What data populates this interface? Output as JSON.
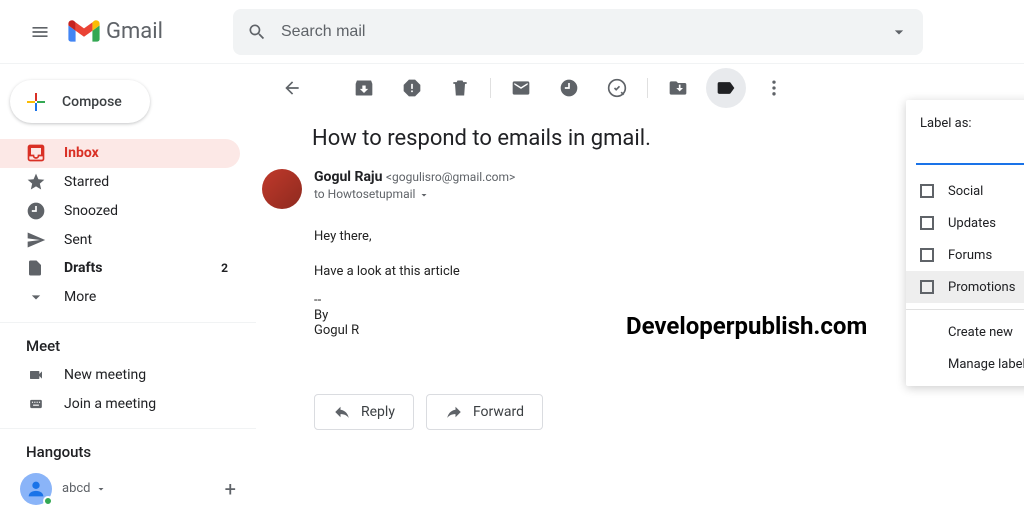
{
  "header": {
    "product": "Gmail",
    "search_placeholder": "Search mail"
  },
  "compose_label": "Compose",
  "sidebar": {
    "items": [
      {
        "label": "Inbox",
        "icon": "inbox"
      },
      {
        "label": "Starred",
        "icon": "star"
      },
      {
        "label": "Snoozed",
        "icon": "clock"
      },
      {
        "label": "Sent",
        "icon": "send"
      },
      {
        "label": "Drafts",
        "icon": "file",
        "count": "2"
      },
      {
        "label": "More",
        "icon": "expand"
      }
    ]
  },
  "meet": {
    "title": "Meet",
    "new_meeting": "New meeting",
    "join_meeting": "Join a meeting"
  },
  "hangouts": {
    "title": "Hangouts",
    "user": "abcd"
  },
  "email": {
    "subject": "How to respond to emails in gmail.",
    "sender_name": "Gogul Raju",
    "sender_email": "<gogulisro@gmail.com>",
    "to_line": "to Howtosetupmail",
    "body_line1": "Hey there,",
    "body_line2": "Have a look at this article",
    "sig_sep": "--",
    "sig_by": "By",
    "sig_name": "Gogul R",
    "reply": "Reply",
    "forward": "Forward"
  },
  "watermark": "Developerpublish.com",
  "label_menu": {
    "title": "Label as:",
    "options": [
      "Social",
      "Updates",
      "Forums",
      "Promotions"
    ],
    "create": "Create new",
    "manage": "Manage labels"
  }
}
